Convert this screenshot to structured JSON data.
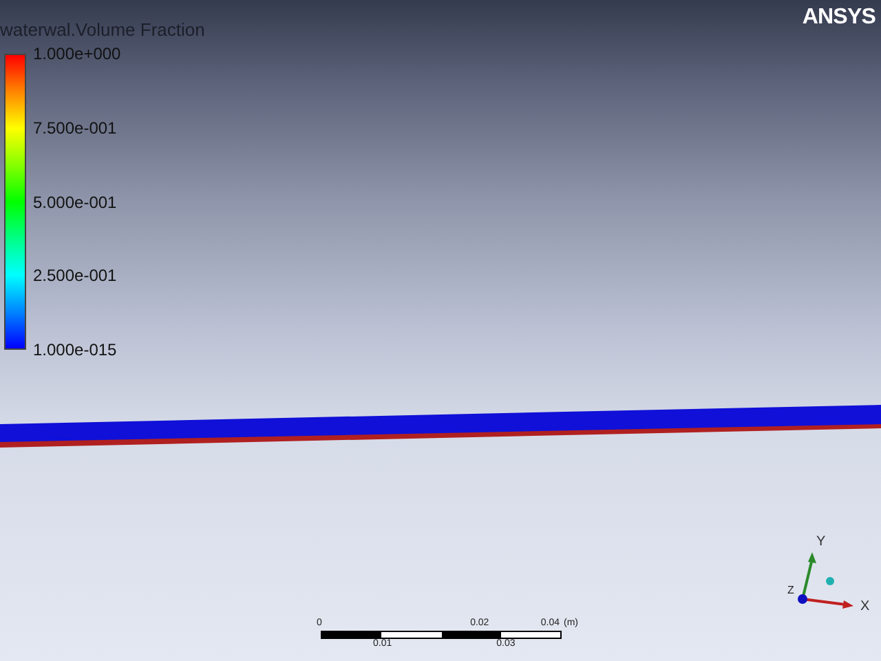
{
  "viewport": {
    "logo": "ANSYS",
    "legend": {
      "title": "waterwal.Volume Fraction",
      "labels": [
        "1.000e+000",
        "7.500e-001",
        "5.000e-001",
        "2.500e-001",
        "1.000e-015"
      ]
    },
    "scale_bar": {
      "top_labels": [
        "0",
        "0.02",
        "0.04"
      ],
      "unit": "(m)",
      "bottom_labels": [
        "0.01",
        "0.03"
      ]
    },
    "axes": {
      "x": "X",
      "y": "Y",
      "z": "Z"
    }
  }
}
